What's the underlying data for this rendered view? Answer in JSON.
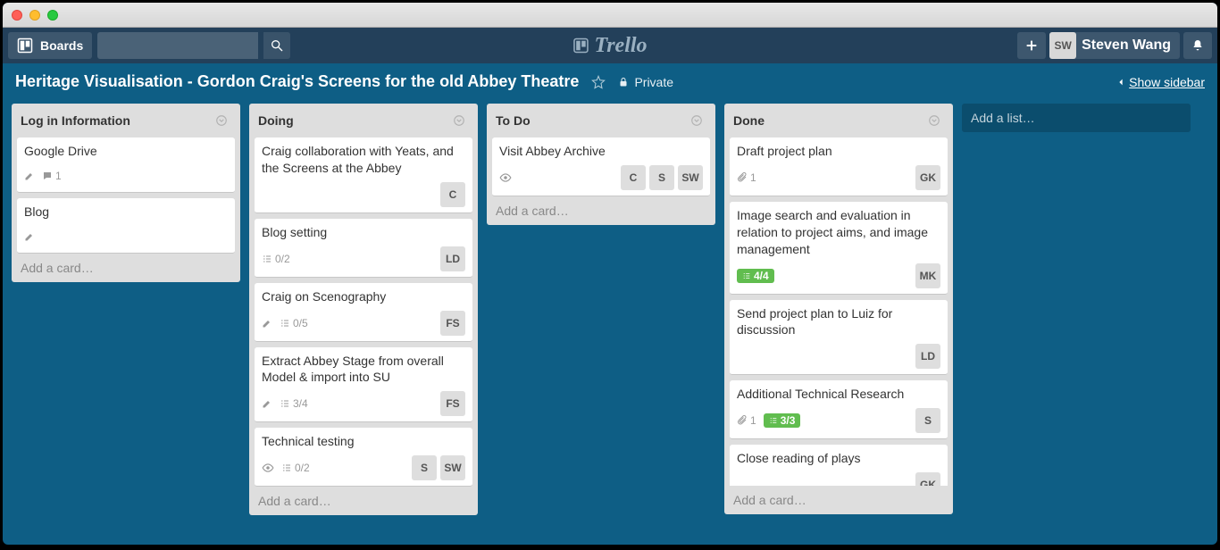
{
  "nav": {
    "boards": "Boards",
    "user_initials": "SW",
    "user_name": "Steven Wang",
    "logo_text": "Trello"
  },
  "board_header": {
    "title": "Heritage Visualisation - Gordon Craig's Screens for the old Abbey Theatre",
    "visibility": "Private",
    "show_sidebar": "Show sidebar"
  },
  "lists": [
    {
      "title": "Log in Information",
      "add_card": "Add a card…",
      "cards": [
        {
          "title": "Google Drive",
          "desc": true,
          "comments": "1"
        },
        {
          "title": "Blog",
          "desc": true
        }
      ]
    },
    {
      "title": "Doing",
      "add_card": "Add a card…",
      "cards": [
        {
          "title": "Craig collaboration with Yeats, and the Screens at the Abbey",
          "members": [
            "C"
          ]
        },
        {
          "title": "Blog setting",
          "checklist": "0/2",
          "members": [
            "LD"
          ]
        },
        {
          "title": "Craig on Scenography",
          "desc": true,
          "checklist": "0/5",
          "members": [
            "FS"
          ]
        },
        {
          "title": "Extract Abbey Stage from overall Model & import into SU",
          "desc": true,
          "checklist": "3/4",
          "members": [
            "FS"
          ]
        },
        {
          "title": "Technical testing",
          "subscribed": true,
          "checklist": "0/2",
          "members": [
            "S",
            "SW"
          ]
        }
      ]
    },
    {
      "title": "To Do",
      "add_card": "Add a card…",
      "cards": [
        {
          "title": "Visit Abbey Archive",
          "subscribed": true,
          "members": [
            "C",
            "S",
            "SW"
          ]
        }
      ]
    },
    {
      "title": "Done",
      "add_card": "Add a card…",
      "cards": [
        {
          "title": "Draft project plan",
          "attach": "1",
          "members": [
            "GK"
          ]
        },
        {
          "title": "Image search and evaluation in relation to project aims, and image management",
          "checklist_done": "4/4",
          "members": [
            "MK"
          ]
        },
        {
          "title": "Send project plan to Luiz for discussion",
          "members": [
            "LD"
          ]
        },
        {
          "title": "Additional Technical Research",
          "attach": "1",
          "checklist_done": "3/3",
          "members": [
            "S"
          ]
        },
        {
          "title": "Close reading of plays",
          "members": [
            "GK"
          ]
        }
      ]
    }
  ],
  "add_list": "Add a list…"
}
